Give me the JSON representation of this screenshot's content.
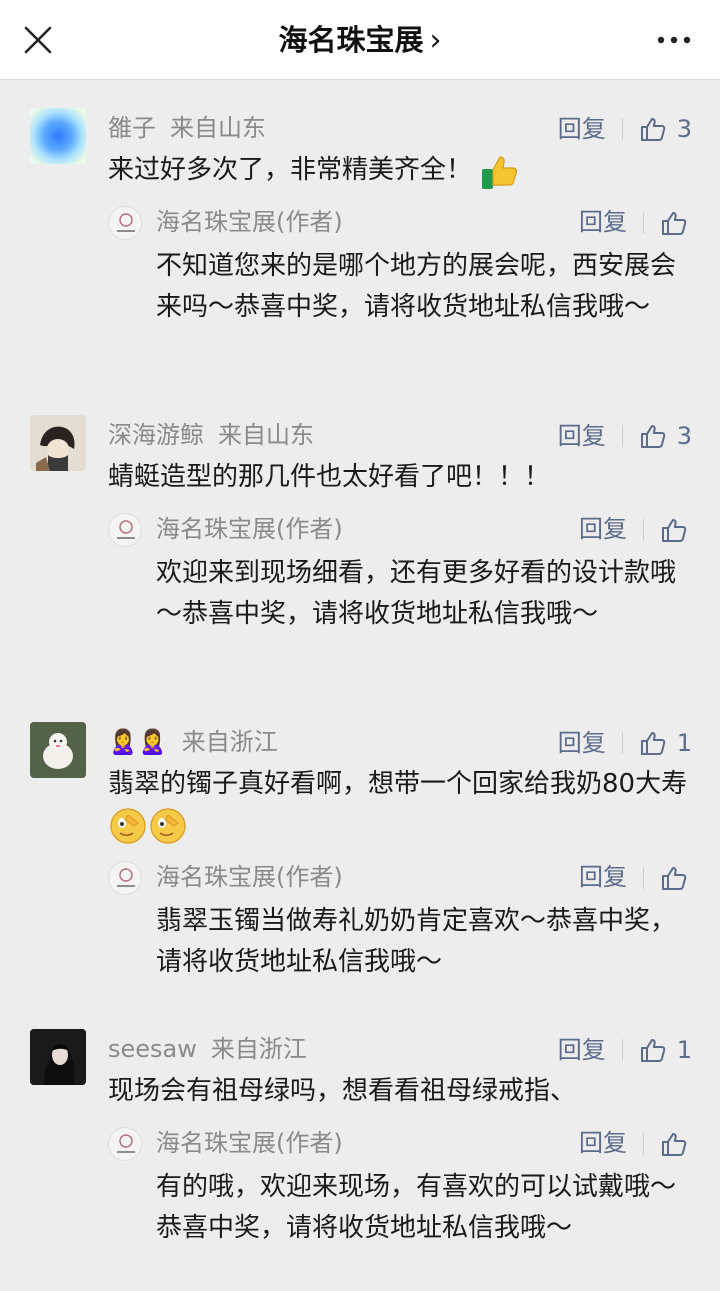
{
  "header": {
    "title": "海名珠宝展",
    "chevron": "›",
    "close_icon": "close-icon",
    "more_icon": "more-dots-icon"
  },
  "colors": {
    "background": "#ededed",
    "link_blue": "#5b6b8c",
    "meta_gray": "#8a8a8a"
  },
  "comments": [
    {
      "user": "雒子",
      "region": "来自山东",
      "reply_label": "回复",
      "likes": "3",
      "text": "来过好多次了，非常精美齐全！",
      "emoji": "thumbs-up-emoji",
      "author_reply": {
        "name": "海名珠宝展(作者)",
        "reply_label": "回复",
        "text": "不知道您来的是哪个地方的展会呢，西安展会来吗～恭喜中奖，请将收货地址私信我哦～"
      }
    },
    {
      "user": "深海游鲸",
      "region": "来自山东",
      "reply_label": "回复",
      "likes": "3",
      "text": "蜻蜓造型的那几件也太好看了吧！！！",
      "author_reply": {
        "name": "海名珠宝展(作者)",
        "reply_label": "回复",
        "text": "欢迎来到现场细看，还有更多好看的设计款哦～恭喜中奖，请将收货地址私信我哦～"
      }
    },
    {
      "user": "🙎‍♀️🙎‍♀️",
      "region": "来自浙江",
      "reply_label": "回复",
      "likes": "1",
      "text": "翡翠的镯子真好看啊，想带一个回家给我奶80大寿",
      "emoji": "salute-face-emoji",
      "author_reply": {
        "name": "海名珠宝展(作者)",
        "reply_label": "回复",
        "text": "翡翠玉镯当做寿礼奶奶肯定喜欢～恭喜中奖，请将收货地址私信我哦～"
      }
    },
    {
      "user": "seesaw",
      "region": "来自浙江",
      "reply_label": "回复",
      "likes": "1",
      "text": "现场会有祖母绿吗，想看看祖母绿戒指、",
      "author_reply": {
        "name": "海名珠宝展(作者)",
        "reply_label": "回复",
        "text": "有的哦，欢迎来现场，有喜欢的可以试戴哦～恭喜中奖，请将收货地址私信我哦～"
      }
    }
  ]
}
